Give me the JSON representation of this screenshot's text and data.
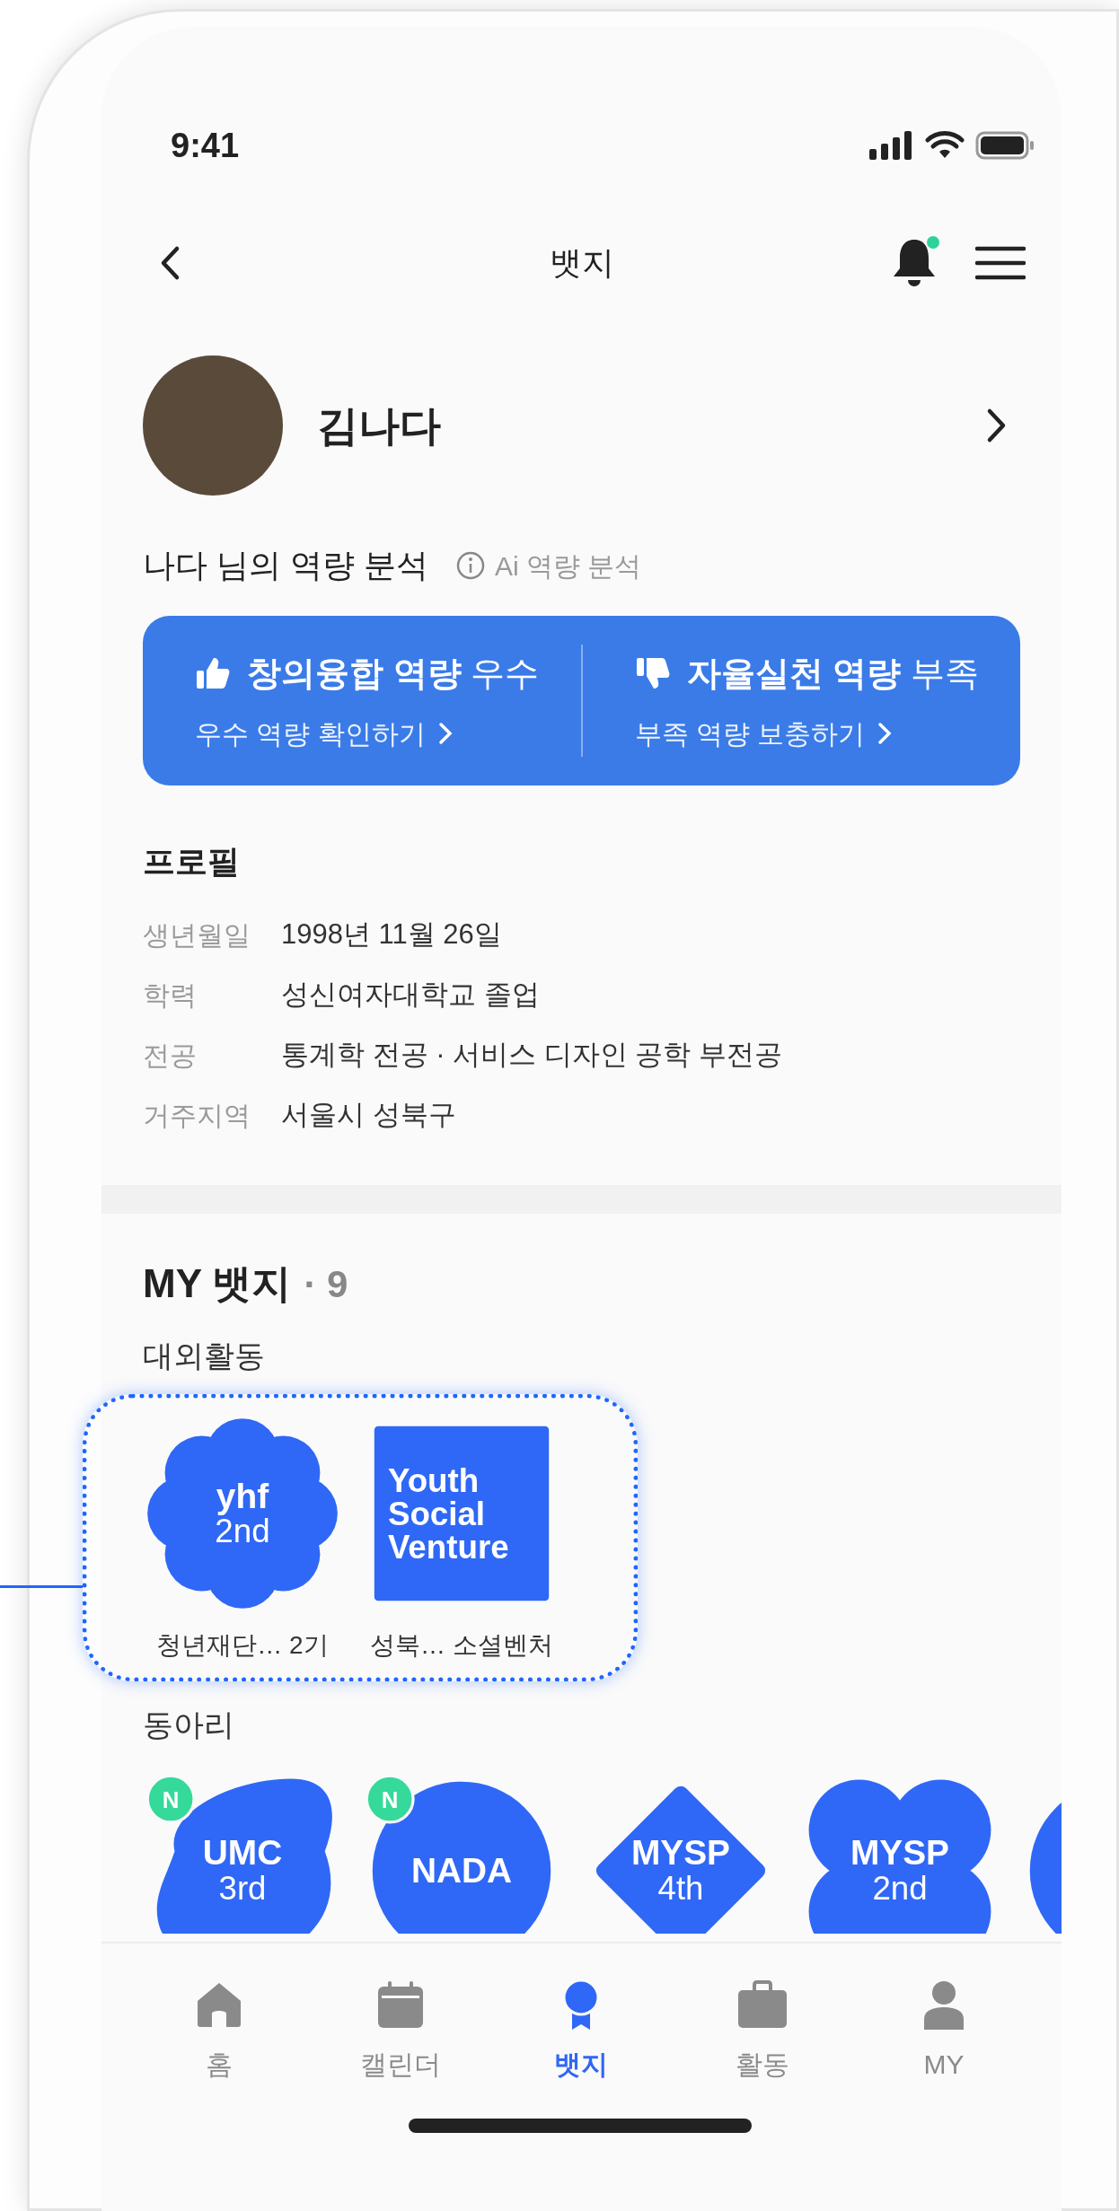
{
  "status_bar": {
    "time": "9:41"
  },
  "nav": {
    "title": "뱃지",
    "notification_dot": true
  },
  "profile": {
    "name": "김나다"
  },
  "analysis": {
    "title": "나다 님의 역량 분석",
    "ai_link": "Ai 역량 분석",
    "items": [
      {
        "kind": "strong",
        "label": "**창의융합 역량** 우수",
        "link": "우수 역량 확인하기"
      },
      {
        "kind": "weak",
        "label": "**자율실천 역량** 부족",
        "link": "부족 역량 보충하기"
      }
    ]
  },
  "profile_info": {
    "title": "프로필",
    "rows": [
      {
        "label": "생년월일",
        "value": "1998년 11월 26일"
      },
      {
        "label": "학력",
        "value": "성신여자대학교 졸업"
      },
      {
        "label": "전공",
        "value": "통계학 전공 · 서비스 디자인 공학 부전공"
      },
      {
        "label": "거주지역",
        "value": "서울시 성북구"
      }
    ]
  },
  "my_badges": {
    "title": "MY 뱃지",
    "count": "· 9",
    "groups": [
      {
        "title": "대외활동",
        "highlighted": true,
        "badges": [
          {
            "kind": "flower",
            "lines": [
              "yhf",
              "2nd"
            ],
            "caption": "청년재단… 2기"
          },
          {
            "kind": "square",
            "lines": [
              "Youth",
              "Social",
              "Venture"
            ],
            "caption": "성북… 소셜벤처"
          }
        ]
      },
      {
        "title": "동아리",
        "highlighted": false,
        "badges": [
          {
            "kind": "blob",
            "lines": [
              "UMC",
              "3rd"
            ],
            "new_badge": "N"
          },
          {
            "kind": "circle",
            "lines": [
              "NADA"
            ],
            "new_badge": "N"
          },
          {
            "kind": "diamond",
            "lines": [
              "MYSP",
              "4th"
            ]
          },
          {
            "kind": "clover",
            "lines": [
              "MYSP",
              "2nd"
            ]
          },
          {
            "kind": "circle"
          }
        ]
      }
    ]
  },
  "tab_bar": [
    {
      "label": "홈",
      "kind": "home",
      "selected": false
    },
    {
      "label": "캘린더",
      "kind": "calendar",
      "selected": false
    },
    {
      "label": "뱃지",
      "kind": "medal",
      "selected": true
    },
    {
      "label": "활동",
      "kind": "briefcase",
      "selected": false
    },
    {
      "label": "MY",
      "kind": "person",
      "selected": false
    }
  ]
}
